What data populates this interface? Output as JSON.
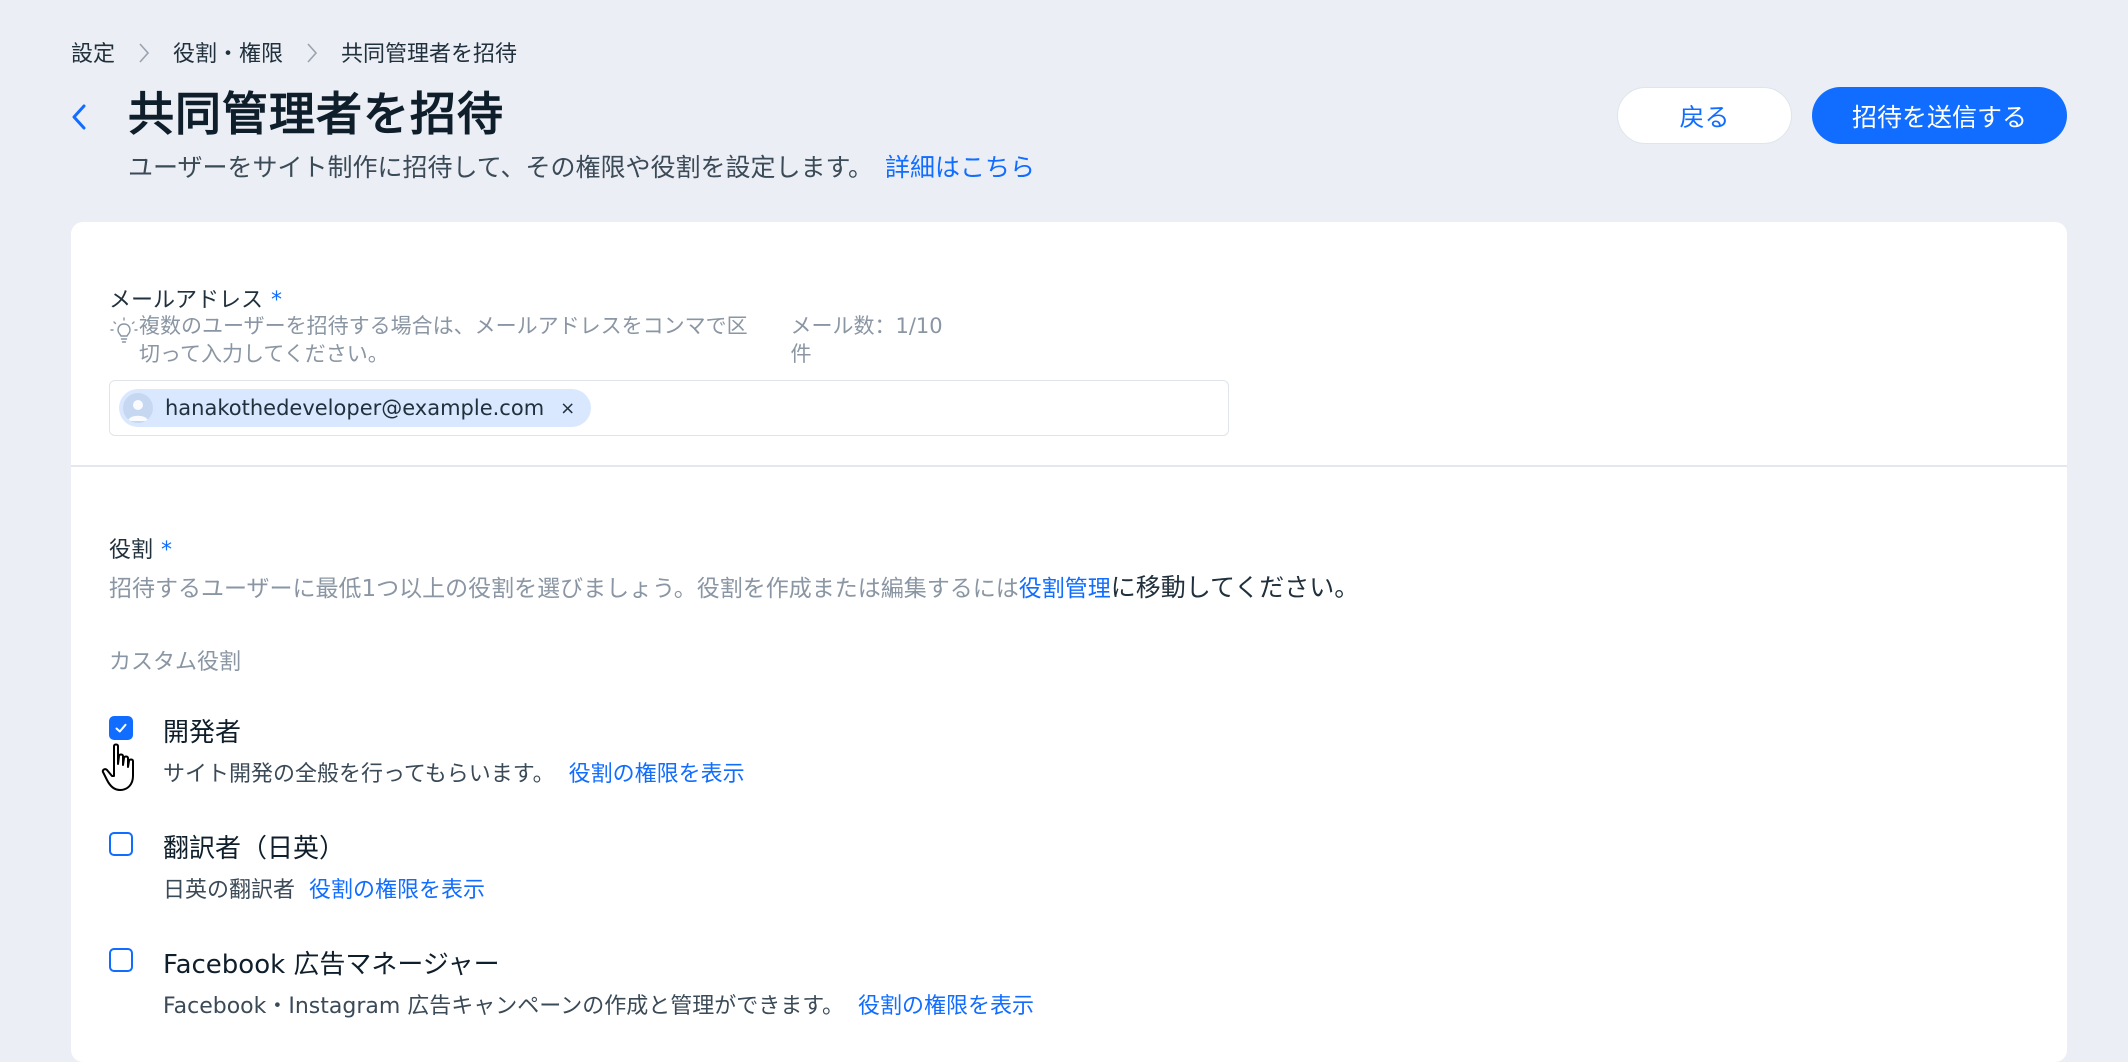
{
  "breadcrumb": {
    "items": [
      "設定",
      "役割・権限",
      "共同管理者を招待"
    ]
  },
  "header": {
    "title": "共同管理者を招待",
    "subtitle": "ユーザーをサイト制作に招待して、その権限や役割を設定します。",
    "learn_more": "詳細はこちら",
    "back_button": "戻る",
    "send_button": "招待を送信する"
  },
  "email_section": {
    "label": "メールアドレス",
    "required_mark": "*",
    "hint": "複数のユーザーを招待する場合は、メールアドレスをコンマで区切って入力してください。",
    "count": "メール数：1/10件",
    "chips": [
      {
        "email": "hanakothedeveloper@example.com",
        "remove": "×"
      }
    ]
  },
  "roles_section": {
    "label": "役割",
    "required_mark": "*",
    "description_prefix": "招待するユーザーに最低1つ以上の役割を選びましょう。役割を作成または編集するには",
    "description_link": "役割管理",
    "description_suffix": "に移動してください。",
    "custom_roles_label": "カスタム役割",
    "roles": [
      {
        "name": "開発者",
        "description": "サイト開発の全般を行ってもらいます。",
        "link": "役割の権限を表示",
        "checked": true
      },
      {
        "name": "翻訳者（日英）",
        "description": "日英の翻訳者",
        "link": "役割の権限を表示",
        "checked": false
      },
      {
        "name": "Facebook 広告マネージャー",
        "description": "Facebook・Instagram 広告キャンペーンの作成と管理ができます。",
        "link": "役割の権限を表示",
        "checked": false
      }
    ]
  },
  "colors": {
    "accent": "#116dff",
    "background": "#ebeef4",
    "chip": "#dae8ff"
  }
}
